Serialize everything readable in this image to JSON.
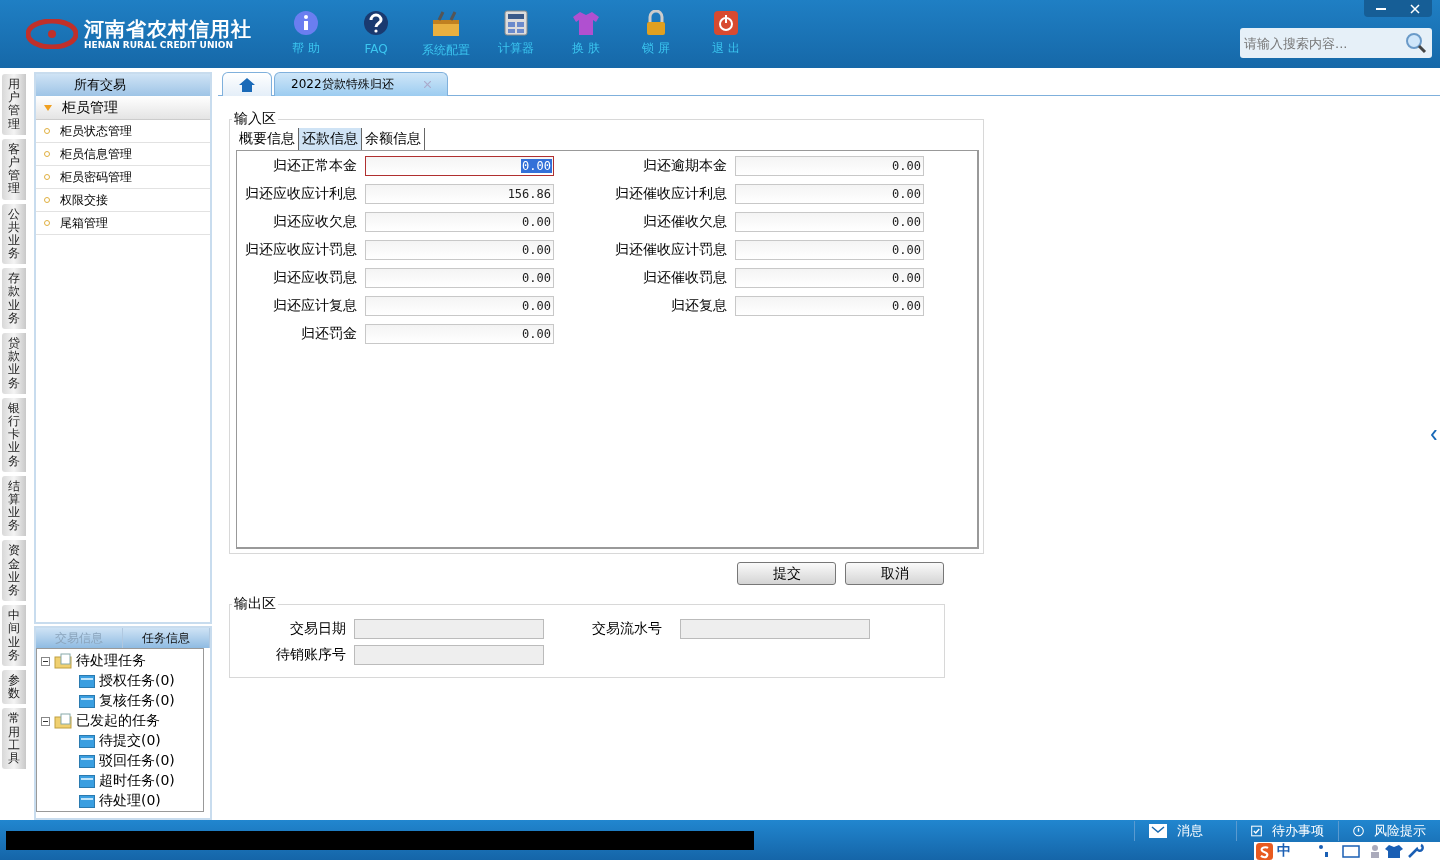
{
  "header": {
    "logo_cn": "河南省农村信用社",
    "logo_en": "HENAN RURAL CREDIT UNION",
    "nav": [
      {
        "kind": "info",
        "label": "帮 助"
      },
      {
        "kind": "faq",
        "label": "FAQ"
      },
      {
        "kind": "config",
        "label": "系统配置"
      },
      {
        "kind": "calc",
        "label": "计算器"
      },
      {
        "kind": "skin",
        "label": "换 肤"
      },
      {
        "kind": "lock",
        "label": "锁 屏"
      },
      {
        "kind": "exit",
        "label": "退 出"
      }
    ],
    "search": {
      "placeholder": "请输入搜索内容..."
    }
  },
  "vertical_tabs": [
    "用户管理",
    "客户管理",
    "公共业务",
    "存款业务",
    "贷款业务",
    "银行卡业务",
    "结算业务",
    "资金业务",
    "中间业务",
    "参数",
    "常用工具"
  ],
  "sidebar": {
    "title": "所有交易",
    "group": {
      "label": "柜员管理",
      "expanded": true,
      "items": [
        "柜员状态管理",
        "柜员信息管理",
        "柜员密码管理",
        "权限交接",
        "尾箱管理"
      ]
    },
    "bottom_tabs": [
      {
        "label": "交易信息",
        "selected": false
      },
      {
        "label": "任务信息",
        "selected": true
      }
    ],
    "tree": [
      {
        "label": "待处理任务",
        "expanded": true,
        "children": [
          {
            "label": "授权任务(0)"
          },
          {
            "label": "复核任务(0)"
          }
        ]
      },
      {
        "label": "已发起的任务",
        "expanded": true,
        "children": [
          {
            "label": "待提交(0)"
          },
          {
            "label": "驳回任务(0)"
          },
          {
            "label": "超时任务(0)"
          },
          {
            "label": "待处理(0)"
          }
        ]
      }
    ]
  },
  "doc_tabs": [
    {
      "kind": "home",
      "selected": false
    },
    {
      "kind": "text",
      "label": "2022贷款特殊归还",
      "selected": true
    }
  ],
  "input_area": {
    "legend": "输入区",
    "tabs": [
      {
        "label": "概要信息",
        "selected": false
      },
      {
        "label": "还款信息",
        "selected": true
      },
      {
        "label": "余额信息",
        "selected": false
      }
    ],
    "left_fields": [
      {
        "label": "归还正常本金",
        "value": "0.00",
        "focused": true
      },
      {
        "label": "归还应收应计利息",
        "value": "156.86",
        "focused": false
      },
      {
        "label": "归还应收欠息",
        "value": "0.00",
        "focused": false
      },
      {
        "label": "归还应收应计罚息",
        "value": "0.00",
        "focused": false
      },
      {
        "label": "归还应收罚息",
        "value": "0.00",
        "focused": false
      },
      {
        "label": "归还应计复息",
        "value": "0.00",
        "focused": false
      },
      {
        "label": "归还罚金",
        "value": "0.00",
        "focused": false
      }
    ],
    "right_fields": [
      {
        "label": "归还逾期本金",
        "value": "0.00",
        "focused": false
      },
      {
        "label": "归还催收应计利息",
        "value": "0.00",
        "focused": false
      },
      {
        "label": "归还催收欠息",
        "value": "0.00",
        "focused": false
      },
      {
        "label": "归还催收应计罚息",
        "value": "0.00",
        "focused": false
      },
      {
        "label": "归还催收罚息",
        "value": "0.00",
        "focused": false
      },
      {
        "label": "归还复息",
        "value": "0.00",
        "focused": false
      }
    ]
  },
  "buttons": [
    "提交",
    "取消"
  ],
  "output_area": {
    "legend": "输出区",
    "fields": [
      {
        "label": "交易日期"
      },
      {
        "label": "交易流水号"
      },
      {
        "label": "待销账序号"
      }
    ]
  },
  "status_bar": {
    "items": [
      {
        "kind": "mail",
        "label": "消息"
      },
      {
        "kind": "check",
        "label": "待办事项"
      },
      {
        "kind": "alert",
        "label": "风险提示"
      }
    ],
    "ime": [
      {
        "kind": "text",
        "label": "中"
      }
    ]
  }
}
